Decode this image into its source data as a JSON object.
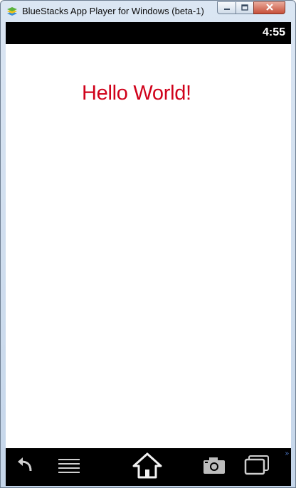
{
  "window": {
    "title": "BlueStacks App Player for Windows (beta-1)",
    "controls": {
      "minimize": "minimize-icon",
      "maximize": "maximize-icon",
      "close": "close-icon"
    }
  },
  "statusbar": {
    "time": "4:55"
  },
  "app": {
    "greeting": "Hello World!",
    "greeting_color": "#d0021b"
  },
  "navbar": {
    "buttons": [
      "back-icon",
      "menu-icon",
      "home-icon",
      "camera-icon",
      "window-switch-icon"
    ],
    "more_indicator": "»"
  }
}
